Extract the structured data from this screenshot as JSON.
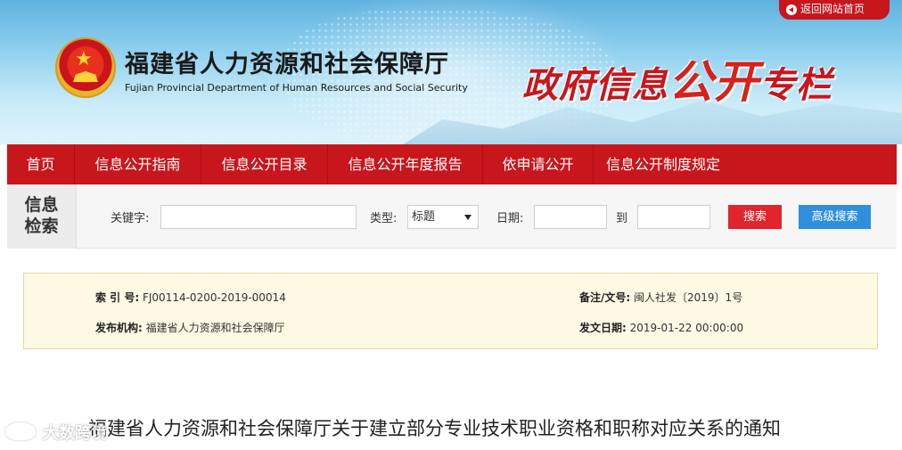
{
  "header": {
    "return_link": "返回网站首页",
    "dept_name_cn": "福建省人力资源和社会保障厅",
    "dept_name_en": "Fujian Provincial Department of Human Resources and Social Security",
    "column_title_part1": "政府信息",
    "column_title_part2": "公开",
    "column_title_part3": "专栏"
  },
  "nav": {
    "items": [
      "首页",
      "信息公开指南",
      "信息公开目录",
      "信息公开年度报告",
      "依申请公开",
      "信息公开制度规定"
    ]
  },
  "search": {
    "title_line1": "信息",
    "title_line2": "检索",
    "keyword_label": "关键字:",
    "keyword_value": "",
    "type_label": "类型:",
    "type_selected": "标题",
    "date_label": "日期:",
    "date_from": "",
    "date_to_label": "到",
    "date_to": "",
    "search_button": "搜索",
    "advanced_button": "高级搜索"
  },
  "info": {
    "index_no_label": "索 引 号:",
    "index_no": "FJ00114-0200-2019-00014",
    "doc_no_label": "备注/文号:",
    "doc_no": "闽人社发〔2019〕1号",
    "publisher_label": "发布机构:",
    "publisher": "福建省人力资源和社会保障厅",
    "date_label": "发文日期:",
    "date": "2019-01-22 00:00:00"
  },
  "article": {
    "title": "福建省人力资源和社会保障厅关于建立部分专业技术职业资格和职称对应关系的通知"
  },
  "watermark": {
    "text": "大数跨境"
  },
  "colors": {
    "brand_red": "#c8161d",
    "search_red": "#e0262c",
    "advanced_blue": "#2f8fdc",
    "info_bg": "#fdf9e4"
  }
}
